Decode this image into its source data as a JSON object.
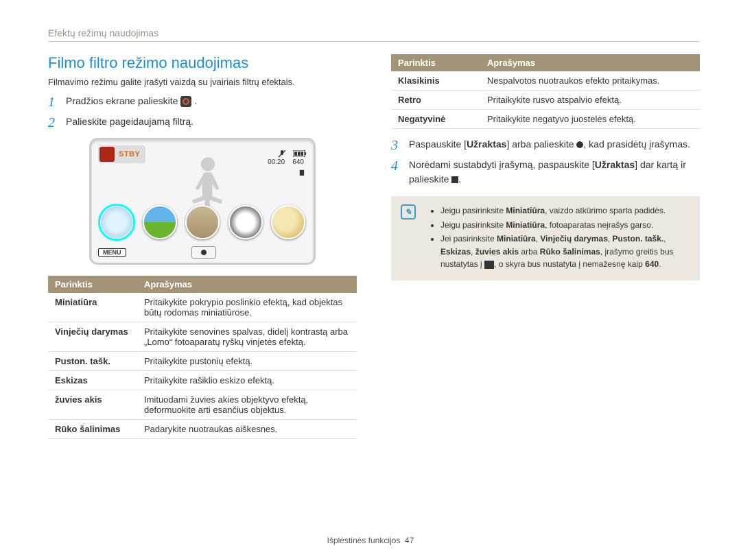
{
  "header": {
    "section": "Efektų režimų naudojimas"
  },
  "title": "Filmo filtro režimo naudojimas",
  "intro": "Filmavimo režimu galite įrašyti vaizdą su įvairiais filtrų efektais.",
  "step1_a": "Pradžios ekrane palieskite ",
  "step1_b": ".",
  "step2": "Palieskite pageidaujamą filtrą.",
  "step3_a": "Paspauskite [",
  "step3_bold": "Užraktas",
  "step3_b": "] arba palieskite ",
  "step3_c": ", kad prasidėtų įrašymas.",
  "step4_a": "Norėdami sustabdyti įrašymą, paspauskite [",
  "step4_bold": "Užraktas",
  "step4_b": "] dar kartą ir palieskite ",
  "step4_c": ".",
  "lcd": {
    "stby": "STBY",
    "time": "00:20",
    "res": "640",
    "menu": "MENU"
  },
  "tableL": {
    "h1": "Parinktis",
    "h2": "Aprašymas",
    "rows": [
      {
        "k": "Miniatiūra",
        "v": "Pritaikykite pokrypio poslinkio efektą, kad objektas būtų rodomas miniatiūrose."
      },
      {
        "k": "Vinječių darymas",
        "v": "Pritaikykite senovines spalvas, didelį kontrastą arba „Lomo“ fotoaparatų ryškų vinjetės efektą."
      },
      {
        "k": "Puston. tašk.",
        "v": "Pritaikykite pustonių efektą."
      },
      {
        "k": "Eskizas",
        "v": "Pritaikykite rašiklio eskizo efektą."
      },
      {
        "k": "žuvies akis",
        "v": "Imituodami žuvies akies objektyvo efektą, deformuokite arti esančius objektus."
      },
      {
        "k": "Rūko šalinimas",
        "v": "Padarykite nuotraukas aiškesnes."
      }
    ]
  },
  "tableR": {
    "h1": "Parinktis",
    "h2": "Aprašymas",
    "rows": [
      {
        "k": "Klasikinis",
        "v": "Nespalvotos nuotraukos efekto pritaikymas."
      },
      {
        "k": "Retro",
        "v": "Pritaikykite rusvo atspalvio efektą."
      },
      {
        "k": "Negatyvinė",
        "v": "Pritaikykite negatyvo juostelės efektą."
      }
    ]
  },
  "note": {
    "li1_a": "Jeigu pasirinksite ",
    "li1_bold": "Miniatiūra",
    "li1_b": ", vaizdo atkūrimo sparta padidės.",
    "li2_a": "Jeigu pasirinksite ",
    "li2_bold": "Miniatiūra",
    "li2_b": ", fotoaparatas neįrašys garso.",
    "li3_a": "Jei pasirinksite ",
    "li3_s1": "Miniatiūra",
    "li3_sep": ", ",
    "li3_s2": "Vinječių darymas",
    "li3_s3": "Puston. tašk.",
    "li3_s4": "Eskizas",
    "li3_s5": "žuvies akis",
    "li3_or": " arba ",
    "li3_s6": "Rūko šalinimas",
    "li3_mid": ", įrašymo greitis bus nustatytas į ",
    "li3_end": ", o skyra bus nustatyta į nemažesnę kaip ",
    "li3_res": "640",
    "li3_dot": "."
  },
  "footer": {
    "chapter": "Išplėstinės funkcijos",
    "page": "47"
  }
}
